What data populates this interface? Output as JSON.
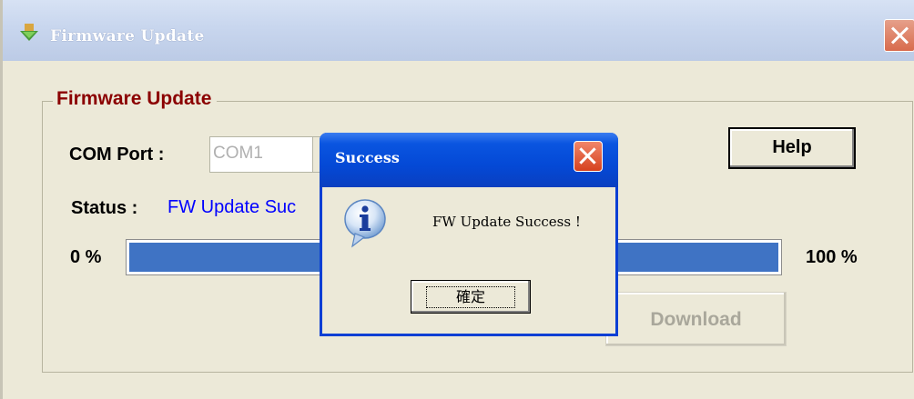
{
  "window": {
    "title": "Firmware Update",
    "title_icon": "download-arrow-icon",
    "close_icon": "close-icon"
  },
  "group": {
    "legend": "Firmware Update"
  },
  "com_port": {
    "label": "COM Port :",
    "value": "COM1"
  },
  "status": {
    "label": "Status :",
    "value": "FW Update Suc"
  },
  "progress": {
    "min_label": "0 %",
    "max_label": "100 %",
    "fraction": 1.0
  },
  "buttons": {
    "help": "Help",
    "download": "Download"
  },
  "dialog": {
    "title": "Success",
    "message": "FW Update Success !",
    "ok": "確定",
    "icon": "info-icon"
  },
  "colors": {
    "legend": "#8b0000",
    "status_text": "#0000ff",
    "progress_fill": "#3f73c4",
    "dialog_title": "#0449d6"
  }
}
